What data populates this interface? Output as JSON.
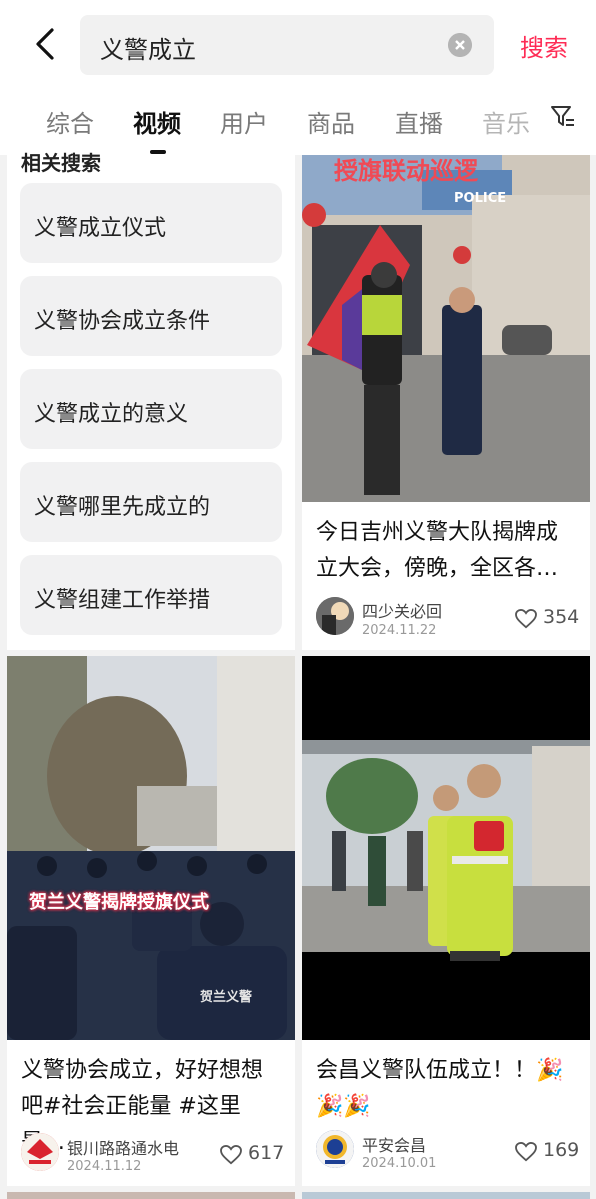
{
  "search": {
    "query": "义警成立",
    "button_label": "搜索"
  },
  "tabs": [
    "综合",
    "视频",
    "用户",
    "商品",
    "直播",
    "音乐"
  ],
  "related": {
    "title": "相关搜索",
    "items": [
      "义警成立仪式",
      "义警协会成立条件",
      "义警成立的意义",
      "义警哪里先成立的",
      "义警组建工作举措"
    ]
  },
  "videos": [
    {
      "overlay": "授旗联动巡逻",
      "sign": "POLICE",
      "title_line1": "今日吉州义警大队揭牌成",
      "title_line2": "立大会，傍晚，全区各…",
      "author": "四少关必回",
      "date": "2024.11.22",
      "likes": "354"
    },
    {
      "overlay": "贺兰义警揭牌授旗仪式",
      "jacket": "贺兰义警",
      "title_line1": "义警协会成立，好好想想",
      "title_line2": "吧#社会正能量 #这里是…",
      "author": "银川路路通水电",
      "date": "2024.11.12",
      "likes": "617"
    },
    {
      "title_line1": "会昌义警队伍成立！！🎉",
      "title_line2": "🎉🎉",
      "author": "平安会昌",
      "date": "2024.10.01",
      "likes": "169"
    }
  ],
  "colors": {
    "accent": "#fe2c55",
    "text": "#222222",
    "muted": "#999999"
  },
  "icons": [
    "back-arrow-icon",
    "clear-icon",
    "filter-icon",
    "heart-icon"
  ]
}
